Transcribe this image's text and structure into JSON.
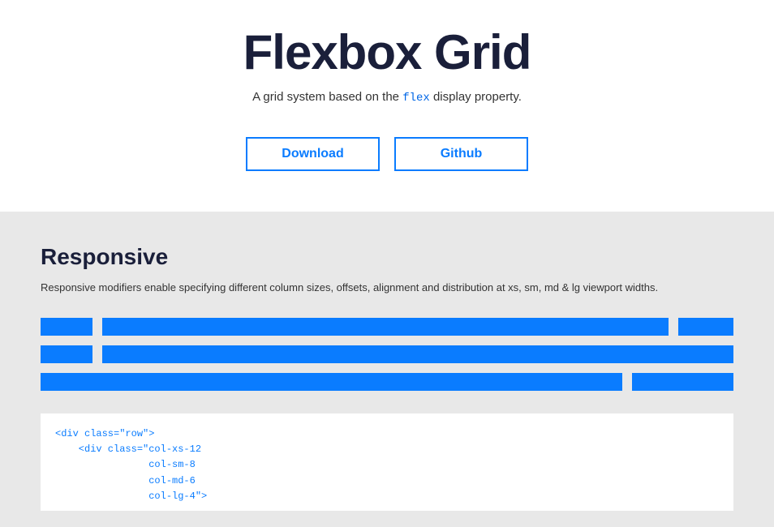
{
  "hero": {
    "title": "Flexbox Grid",
    "subtitle_pre": "A grid system based on the ",
    "subtitle_code": "flex",
    "subtitle_post": " display property.",
    "buttons": {
      "download": "Download",
      "github": "Github"
    }
  },
  "section": {
    "title": "Responsive",
    "description": "Responsive modifiers enable specifying different column sizes, offsets, alignment and distribution at xs, sm, md & lg viewport widths."
  },
  "code": {
    "line1": "<div class=\"row\">",
    "line2": "    <div class=\"col-xs-12",
    "line3": "                col-sm-8",
    "line4": "                col-md-6",
    "line5": "                col-lg-4\">"
  }
}
